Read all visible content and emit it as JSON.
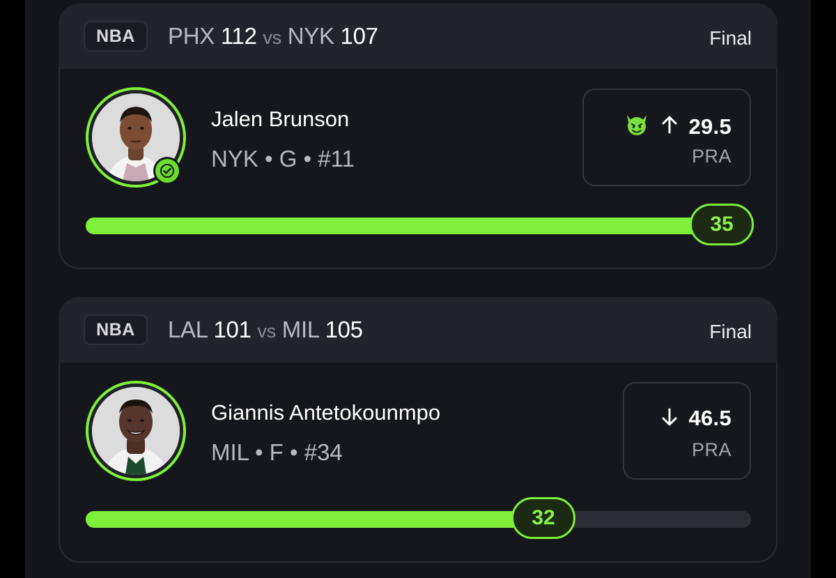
{
  "cards": [
    {
      "league": "NBA",
      "away_team": "PHX",
      "away_score": "112",
      "vs": "vs",
      "home_team": "NYK",
      "home_score": "107",
      "status": "Final",
      "player_name": "Jalen Brunson",
      "player_meta": "NYK • G • #11",
      "direction_icon": "arrow-up-icon",
      "badge_icon": "devil-emoji-icon",
      "line": "29.5",
      "stat": "PRA",
      "result": "35",
      "progress_fraction": 1.0,
      "hit": true
    },
    {
      "league": "NBA",
      "away_team": "LAL",
      "away_score": "101",
      "vs": "vs",
      "home_team": "MIL",
      "home_score": "105",
      "status": "Final",
      "player_name": "Giannis Antetokounmpo",
      "player_meta": "MIL • F • #34",
      "direction_icon": "arrow-down-icon",
      "line": "46.5",
      "stat": "PRA",
      "result": "32",
      "progress_fraction": 0.688,
      "hit": false
    }
  ],
  "colors": {
    "accent": "#7ef03a",
    "background": "#16171d",
    "header": "#22232b"
  }
}
